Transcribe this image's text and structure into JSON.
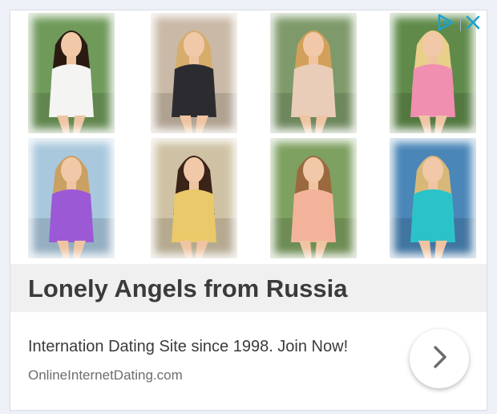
{
  "ad": {
    "headline": "Lonely Angels from Russia",
    "description": "Internation Dating Site since 1998. Join Now!",
    "domain": "OnlineInternetDating.com",
    "adchoices_icon": "adchoices-icon",
    "close_icon": "close-icon",
    "cta_icon": "chevron-right-icon",
    "accent_color": "#1aa3cc"
  },
  "photos": [
    {
      "name": "photo-1",
      "scene": "woman in white dress on park bench",
      "bg": "#6f9a5a",
      "outfit": "#f4f4f2",
      "hair": "#2b1a12"
    },
    {
      "name": "photo-2",
      "scene": "blonde woman portrait",
      "bg": "#c9b9a6",
      "outfit": "#2c2c30",
      "hair": "#d7ad6c"
    },
    {
      "name": "photo-3",
      "scene": "blonde woman in floral blouse",
      "bg": "#7e9a6a",
      "outfit": "#e9cdb8",
      "hair": "#d2a05a"
    },
    {
      "name": "photo-4",
      "scene": "woman in pink dress by tree",
      "bg": "#5f8a4a",
      "outfit": "#f08fb0",
      "hair": "#e8cf8a"
    },
    {
      "name": "photo-5",
      "scene": "blonde woman in purple bikini",
      "bg": "#a9c8dd",
      "outfit": "#9b59d6",
      "hair": "#caa063"
    },
    {
      "name": "photo-6",
      "scene": "woman in yellow swimsuit on sand",
      "bg": "#cfc2a4",
      "outfit": "#e9c96a",
      "hair": "#3a2418"
    },
    {
      "name": "photo-7",
      "scene": "woman in peach dress at balustrade",
      "bg": "#7ea060",
      "outfit": "#f3b39b",
      "hair": "#9a6a3e"
    },
    {
      "name": "photo-8",
      "scene": "woman in turquoise bikini at sea",
      "bg": "#4a86b8",
      "outfit": "#2bc3c9",
      "hair": "#d8b878"
    }
  ]
}
